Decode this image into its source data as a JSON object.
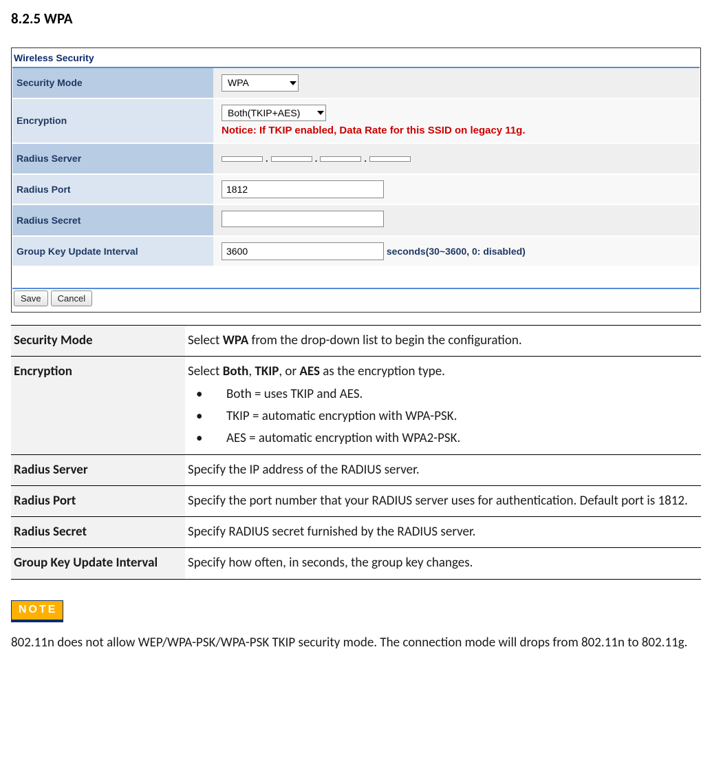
{
  "section_number": "8.2.5",
  "section_title": "WPA",
  "ui": {
    "panel_header": "Wireless Security",
    "rows": {
      "security_mode_label": "Security Mode",
      "security_mode_value": "WPA",
      "encryption_label": "Encryption",
      "encryption_value": "Both(TKIP+AES)",
      "encryption_notice": "Notice: If TKIP enabled, Data Rate for this SSID on legacy 11g.",
      "radius_server_label": "Radius Server",
      "radius_server_values": [
        "",
        "",
        "",
        ""
      ],
      "radius_port_label": "Radius Port",
      "radius_port_value": "1812",
      "radius_secret_label": "Radius Secret",
      "radius_secret_value": "",
      "gkui_label": "Group Key Update Interval",
      "gkui_value": "3600",
      "gkui_suffix": "seconds(30~3600, 0: disabled)"
    },
    "buttons": {
      "save": "Save",
      "cancel": "Cancel"
    }
  },
  "desc": {
    "r1_label": "Security Mode",
    "r1_pre": "Select ",
    "r1_bold": "WPA",
    "r1_post": " from the drop-down list to begin the configuration.",
    "r2_label": "Encryption",
    "r2_pre": "Select ",
    "r2_b1": "Both",
    "r2_mid1": ", ",
    "r2_b2": "TKIP",
    "r2_mid2": ", or ",
    "r2_b3": "AES",
    "r2_post": " as the encryption type.",
    "r2_bul1": "Both = uses TKIP and AES.",
    "r2_bul2": "TKIP = automatic encryption with WPA-PSK.",
    "r2_bul3": "AES = automatic encryption with WPA2-PSK.",
    "r3_label": "Radius Server",
    "r3_text": "Specify the IP address of the RADIUS server.",
    "r4_label": "Radius Port",
    "r4_text": "Specify the port number that your RADIUS server uses for authentication. Default port is 1812.",
    "r5_label": "Radius Secret",
    "r5_text": "Specify RADIUS secret furnished by the RADIUS server.",
    "r6_label": "Group Key Update Interval",
    "r6_text": "Specify how often, in seconds, the group key changes."
  },
  "note": {
    "badge": "NOTE",
    "text": "802.11n does not allow WEP/WPA-PSK/WPA-PSK TKIP security mode. The connection mode will drops from 802.11n to 802.11g."
  }
}
